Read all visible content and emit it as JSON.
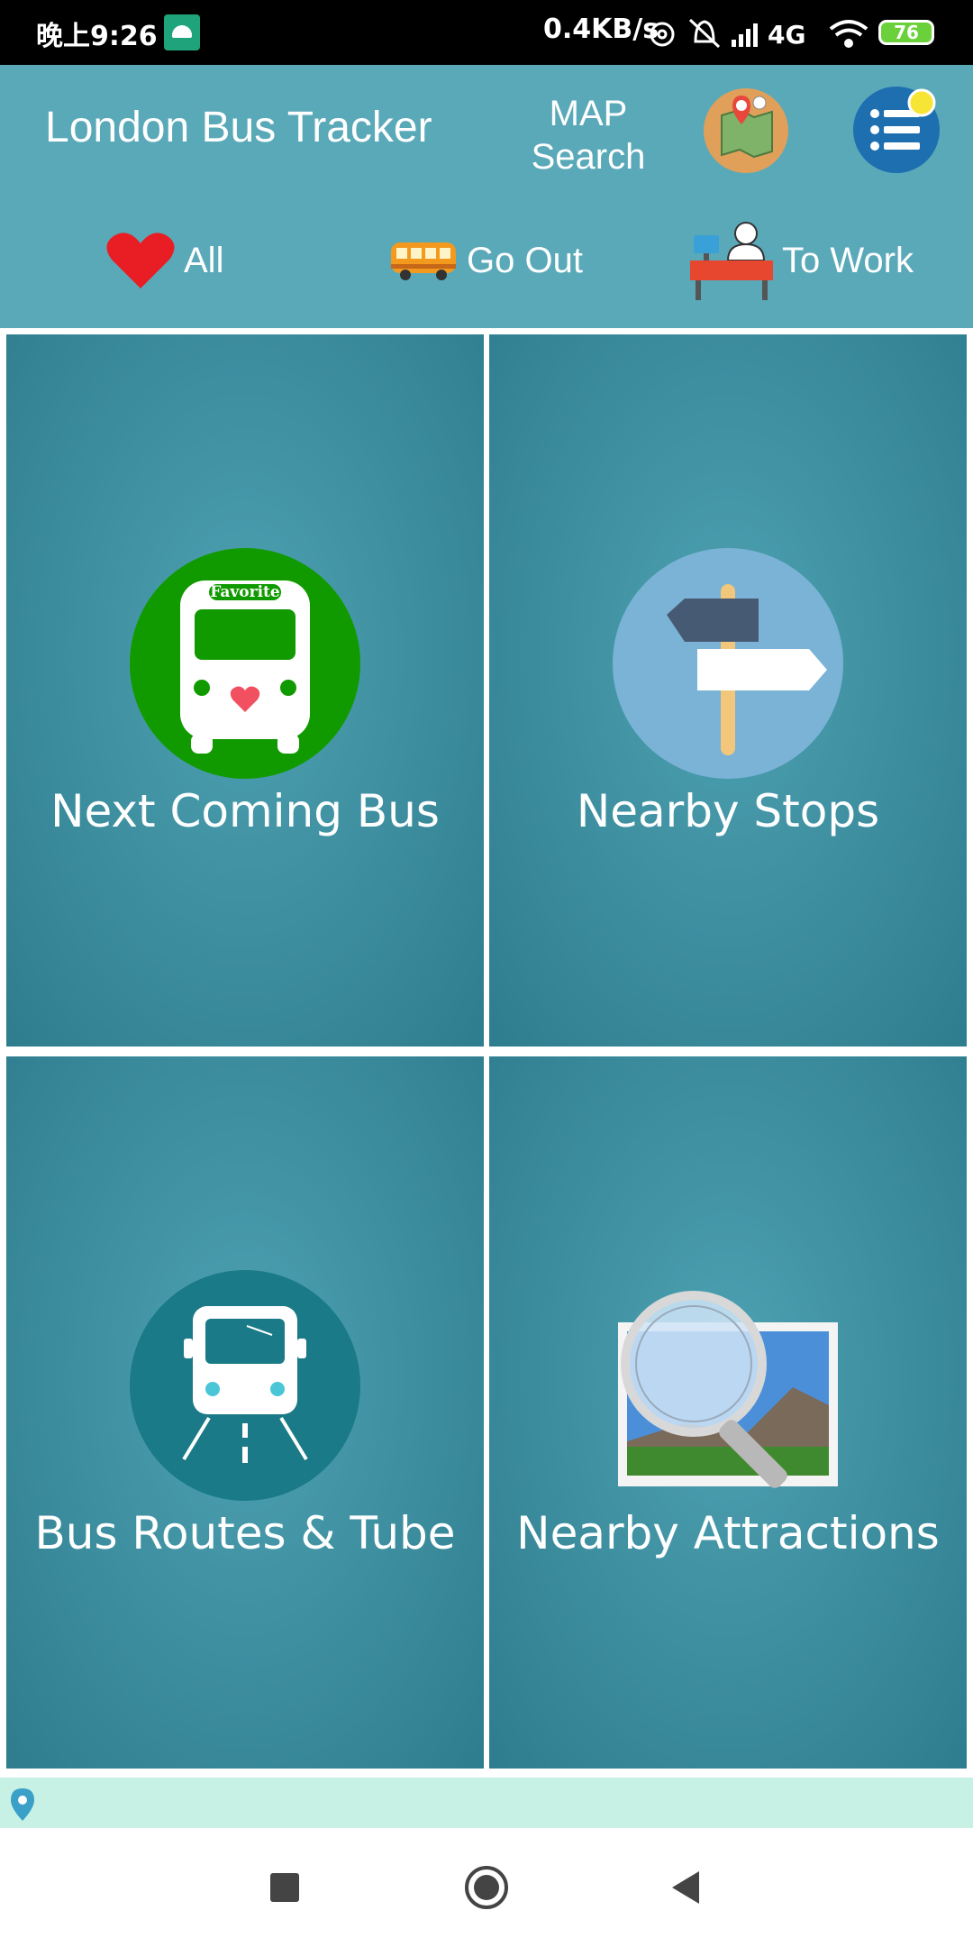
{
  "status_bar": {
    "time": "晚上9:26",
    "network_speed": "0.4KB/s",
    "network_type": "4G",
    "battery": "76"
  },
  "header": {
    "title": "London Bus Tracker",
    "map_search_line1": "MAP",
    "map_search_line2": "Search"
  },
  "filters": [
    {
      "label": "All",
      "icon": "heart-icon"
    },
    {
      "label": "Go Out",
      "icon": "bus-icon"
    },
    {
      "label": "To Work",
      "icon": "desk-worker-icon"
    }
  ],
  "tiles": [
    {
      "label": "Next Coming Bus",
      "icon": "favorite-bus-icon",
      "icon_text": "Favorite"
    },
    {
      "label": "Nearby Stops",
      "icon": "signpost-icon"
    },
    {
      "label": "Bus Routes & Tube",
      "icon": "bus-route-icon"
    },
    {
      "label": "Nearby Attractions",
      "icon": "magnifier-photo-icon"
    }
  ],
  "colors": {
    "header_bg": "#5aa9b9",
    "tile_bg": "#3c8d9e",
    "favorite_green": "#119a00",
    "ad_bar_bg": "#c6f1e4"
  }
}
